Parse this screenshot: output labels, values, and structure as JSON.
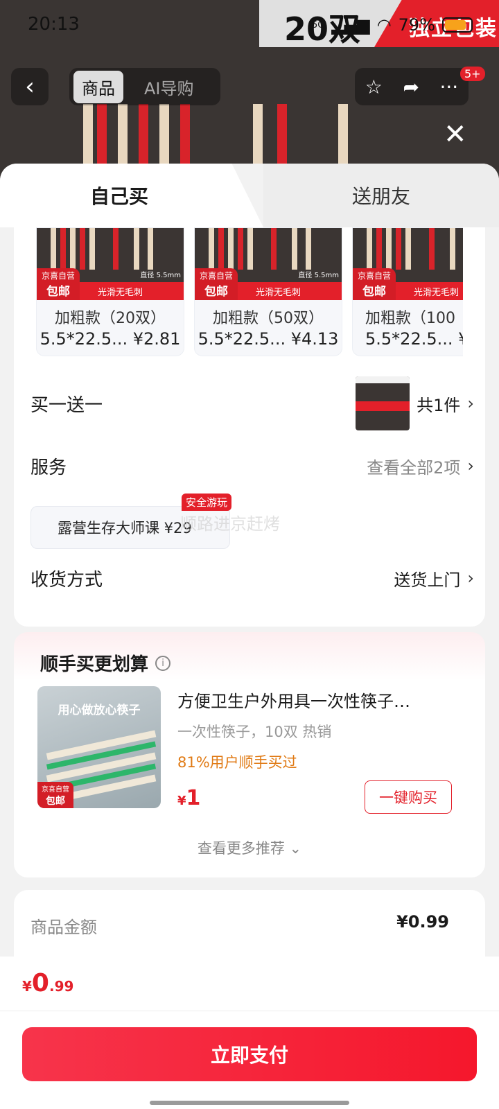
{
  "status_bar": {
    "time": "20:13",
    "net": "5G",
    "battery": "79%"
  },
  "banner": {
    "count": "20双",
    "label": "独立包装"
  },
  "nav": {
    "back": "‹",
    "tabs": [
      "商品",
      "AI导购"
    ],
    "badge": "5+"
  },
  "sheet_tabs": {
    "self": "自己买",
    "friend": "送朋友"
  },
  "variants": [
    {
      "title": "加粗款（20双）",
      "sub": "5.5*22.5... ¥2.81",
      "badge_top": "京喜自营",
      "badge_main": "包邮",
      "strip": "光滑无毛刺",
      "note": "直径 5.5mm"
    },
    {
      "title": "加粗款（50双）",
      "sub": "5.5*22.5... ¥4.13",
      "badge_top": "京喜自营",
      "badge_main": "包邮",
      "strip": "光滑无毛刺",
      "note": "直径 5.5mm"
    },
    {
      "title": "加粗款（100",
      "sub": "5.5*22.5... ¥",
      "badge_top": "京喜自营",
      "badge_main": "包邮",
      "strip": "光滑无毛刺",
      "note": ""
    }
  ],
  "bogo": {
    "label": "买一送一",
    "count": "共1件"
  },
  "service": {
    "label": "服务",
    "view_all": "查看全部2项",
    "chip": "露营生存大师课  ¥29",
    "chip_tag": "安全游玩",
    "watermark": "顺路进京赶烤"
  },
  "delivery": {
    "label": "收货方式",
    "value": "送货上门"
  },
  "addon": {
    "title": "顺手买更划算",
    "image_heading": "用心做放心筷子",
    "badge_top": "京喜自营",
    "badge_main": "包邮",
    "name": "方便卫生户外用具一次性筷子…",
    "spec": "一次性筷子，10双 热销",
    "rate": "81%用户顺手买过",
    "price_symbol": "¥",
    "price": "1",
    "buy_label": "一键购买",
    "more": "查看更多推荐 ⌄"
  },
  "summary": {
    "label": "商品金额",
    "value": "¥0.99"
  },
  "total": {
    "symbol": "¥",
    "integer": "0",
    "decimal": ".99"
  },
  "pay_label": "立即支付",
  "colors": {
    "accent": "#e3202a",
    "rate_orange": "#e07a14"
  }
}
